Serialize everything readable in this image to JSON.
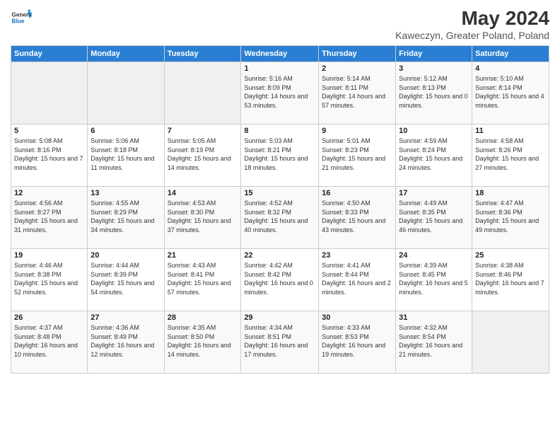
{
  "header": {
    "logo": {
      "general": "General",
      "blue": "Blue"
    },
    "title": "May 2024",
    "subtitle": "Kaweczyn, Greater Poland, Poland"
  },
  "calendar": {
    "weekdays": [
      "Sunday",
      "Monday",
      "Tuesday",
      "Wednesday",
      "Thursday",
      "Friday",
      "Saturday"
    ],
    "weeks": [
      [
        {
          "day": "",
          "info": ""
        },
        {
          "day": "",
          "info": ""
        },
        {
          "day": "",
          "info": ""
        },
        {
          "day": "1",
          "info": "Sunrise: 5:16 AM\nSunset: 8:09 PM\nDaylight: 14 hours and 53 minutes."
        },
        {
          "day": "2",
          "info": "Sunrise: 5:14 AM\nSunset: 8:11 PM\nDaylight: 14 hours and 57 minutes."
        },
        {
          "day": "3",
          "info": "Sunrise: 5:12 AM\nSunset: 8:13 PM\nDaylight: 15 hours and 0 minutes."
        },
        {
          "day": "4",
          "info": "Sunrise: 5:10 AM\nSunset: 8:14 PM\nDaylight: 15 hours and 4 minutes."
        }
      ],
      [
        {
          "day": "5",
          "info": "Sunrise: 5:08 AM\nSunset: 8:16 PM\nDaylight: 15 hours and 7 minutes."
        },
        {
          "day": "6",
          "info": "Sunrise: 5:06 AM\nSunset: 8:18 PM\nDaylight: 15 hours and 11 minutes."
        },
        {
          "day": "7",
          "info": "Sunrise: 5:05 AM\nSunset: 8:19 PM\nDaylight: 15 hours and 14 minutes."
        },
        {
          "day": "8",
          "info": "Sunrise: 5:03 AM\nSunset: 8:21 PM\nDaylight: 15 hours and 18 minutes."
        },
        {
          "day": "9",
          "info": "Sunrise: 5:01 AM\nSunset: 8:23 PM\nDaylight: 15 hours and 21 minutes."
        },
        {
          "day": "10",
          "info": "Sunrise: 4:59 AM\nSunset: 8:24 PM\nDaylight: 15 hours and 24 minutes."
        },
        {
          "day": "11",
          "info": "Sunrise: 4:58 AM\nSunset: 8:26 PM\nDaylight: 15 hours and 27 minutes."
        }
      ],
      [
        {
          "day": "12",
          "info": "Sunrise: 4:56 AM\nSunset: 8:27 PM\nDaylight: 15 hours and 31 minutes."
        },
        {
          "day": "13",
          "info": "Sunrise: 4:55 AM\nSunset: 8:29 PM\nDaylight: 15 hours and 34 minutes."
        },
        {
          "day": "14",
          "info": "Sunrise: 4:53 AM\nSunset: 8:30 PM\nDaylight: 15 hours and 37 minutes."
        },
        {
          "day": "15",
          "info": "Sunrise: 4:52 AM\nSunset: 8:32 PM\nDaylight: 15 hours and 40 minutes."
        },
        {
          "day": "16",
          "info": "Sunrise: 4:50 AM\nSunset: 8:33 PM\nDaylight: 15 hours and 43 minutes."
        },
        {
          "day": "17",
          "info": "Sunrise: 4:49 AM\nSunset: 8:35 PM\nDaylight: 15 hours and 46 minutes."
        },
        {
          "day": "18",
          "info": "Sunrise: 4:47 AM\nSunset: 8:36 PM\nDaylight: 15 hours and 49 minutes."
        }
      ],
      [
        {
          "day": "19",
          "info": "Sunrise: 4:46 AM\nSunset: 8:38 PM\nDaylight: 15 hours and 52 minutes."
        },
        {
          "day": "20",
          "info": "Sunrise: 4:44 AM\nSunset: 8:39 PM\nDaylight: 15 hours and 54 minutes."
        },
        {
          "day": "21",
          "info": "Sunrise: 4:43 AM\nSunset: 8:41 PM\nDaylight: 15 hours and 57 minutes."
        },
        {
          "day": "22",
          "info": "Sunrise: 4:42 AM\nSunset: 8:42 PM\nDaylight: 16 hours and 0 minutes."
        },
        {
          "day": "23",
          "info": "Sunrise: 4:41 AM\nSunset: 8:44 PM\nDaylight: 16 hours and 2 minutes."
        },
        {
          "day": "24",
          "info": "Sunrise: 4:39 AM\nSunset: 8:45 PM\nDaylight: 16 hours and 5 minutes."
        },
        {
          "day": "25",
          "info": "Sunrise: 4:38 AM\nSunset: 8:46 PM\nDaylight: 16 hours and 7 minutes."
        }
      ],
      [
        {
          "day": "26",
          "info": "Sunrise: 4:37 AM\nSunset: 8:48 PM\nDaylight: 16 hours and 10 minutes."
        },
        {
          "day": "27",
          "info": "Sunrise: 4:36 AM\nSunset: 8:49 PM\nDaylight: 16 hours and 12 minutes."
        },
        {
          "day": "28",
          "info": "Sunrise: 4:35 AM\nSunset: 8:50 PM\nDaylight: 16 hours and 14 minutes."
        },
        {
          "day": "29",
          "info": "Sunrise: 4:34 AM\nSunset: 8:51 PM\nDaylight: 16 hours and 17 minutes."
        },
        {
          "day": "30",
          "info": "Sunrise: 4:33 AM\nSunset: 8:53 PM\nDaylight: 16 hours and 19 minutes."
        },
        {
          "day": "31",
          "info": "Sunrise: 4:32 AM\nSunset: 8:54 PM\nDaylight: 16 hours and 21 minutes."
        },
        {
          "day": "",
          "info": ""
        }
      ]
    ]
  }
}
